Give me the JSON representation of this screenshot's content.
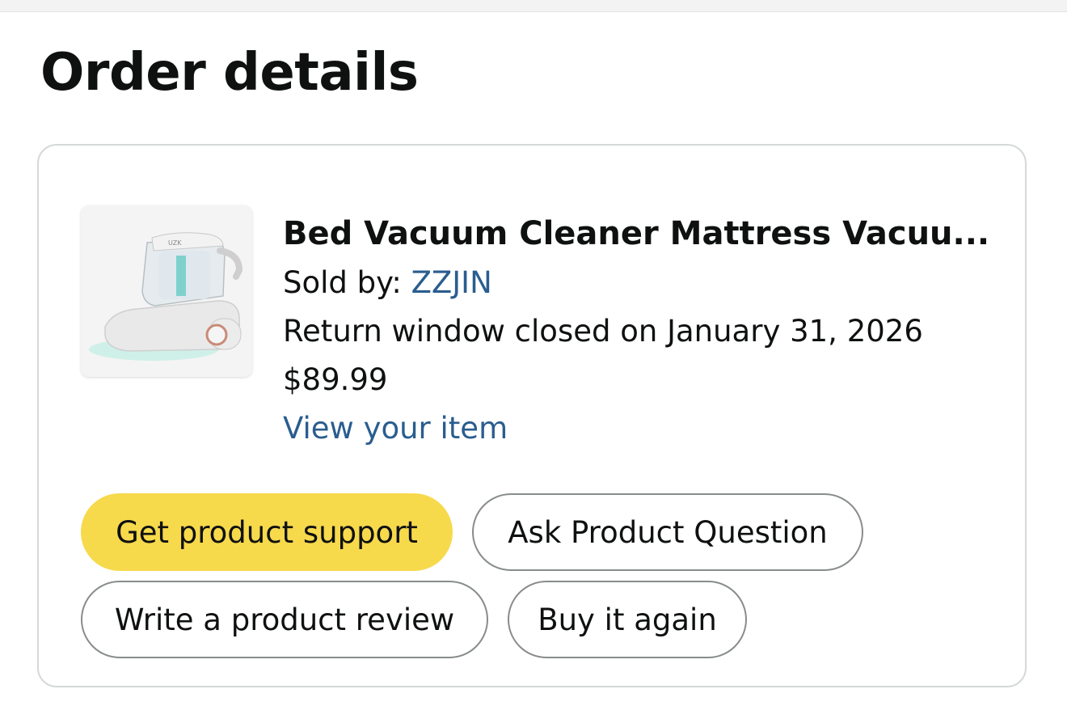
{
  "page": {
    "title": "Order details"
  },
  "item": {
    "title": "Bed Vacuum Cleaner Mattress Vacuu...",
    "sold_by_label": "Sold by:",
    "seller": "ZZJIN",
    "return_window": "Return window closed on January 31, 2026",
    "price": "$89.99",
    "view_link": "View your item",
    "image_brand_text": "UZK"
  },
  "actions": {
    "product_support": "Get product support",
    "ask_question": "Ask Product Question",
    "write_review": "Write a product review",
    "buy_again": "Buy it again"
  },
  "colors": {
    "primary_button": "#f7d94c",
    "link": "#2a5d8f",
    "border": "#d5d9d9"
  }
}
